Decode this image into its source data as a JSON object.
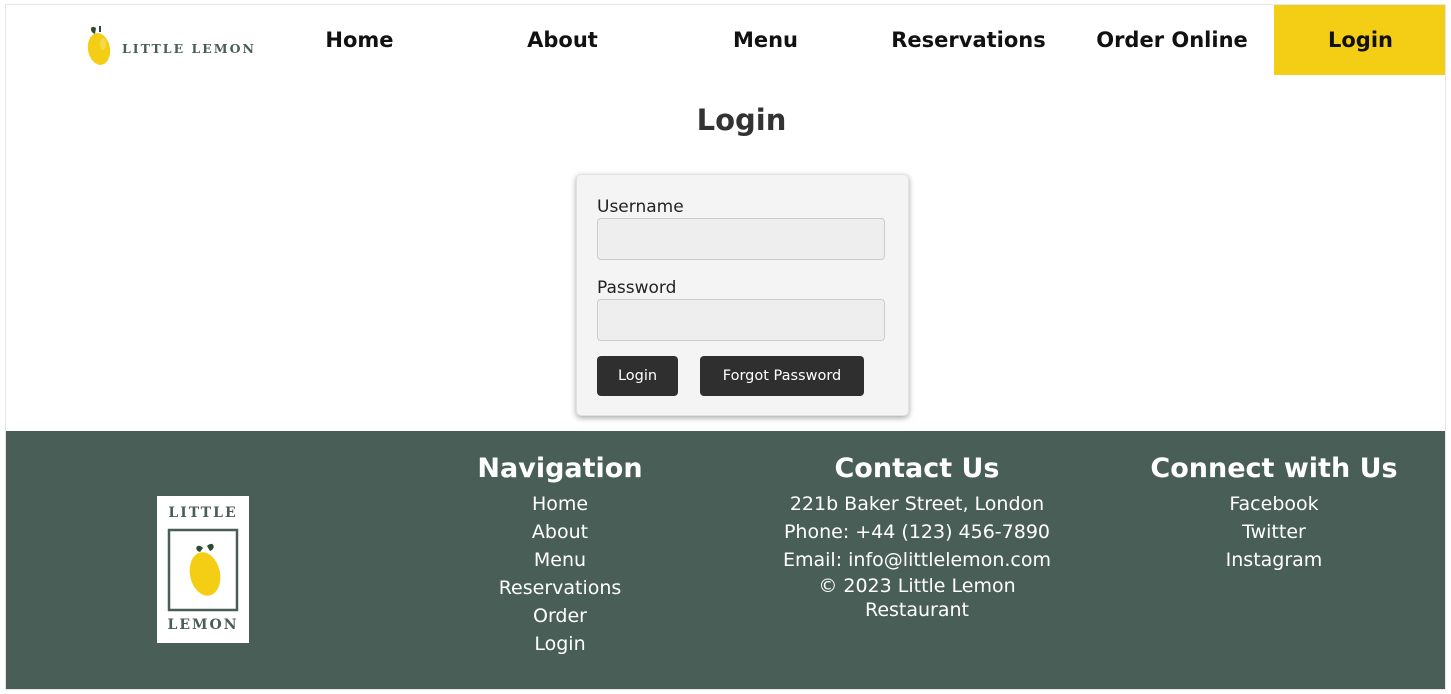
{
  "header": {
    "logo_text": "LITTLE LEMON",
    "nav": [
      {
        "label": "Home",
        "active": false
      },
      {
        "label": "About",
        "active": false
      },
      {
        "label": "Menu",
        "active": false
      },
      {
        "label": "Reservations",
        "active": false
      },
      {
        "label": "Order Online",
        "active": false
      },
      {
        "label": "Login",
        "active": true
      }
    ]
  },
  "main": {
    "title": "Login",
    "form": {
      "username_label": "Username",
      "username_value": "",
      "password_label": "Password",
      "password_value": "",
      "login_button": "Login",
      "forgot_button": "Forgot Password"
    }
  },
  "footer": {
    "logo_top": "LITTLE",
    "logo_bottom": "LEMON",
    "navigation": {
      "title": "Navigation",
      "links": [
        "Home",
        "About",
        "Menu",
        "Reservations",
        "Order",
        "Login"
      ]
    },
    "contact": {
      "title": "Contact Us",
      "address": "221b Baker Street, London",
      "phone": "Phone: +44 (123) 456-7890",
      "email": "Email: info@littlelemon.com",
      "copyright": "© 2023 Little Lemon Restaurant"
    },
    "social": {
      "title": "Connect with Us",
      "links": [
        "Facebook",
        "Twitter",
        "Instagram"
      ]
    }
  },
  "colors": {
    "primary_yellow": "#f4ce14",
    "primary_green": "#495e57",
    "button_dark": "#2f2f2f",
    "card_bg": "#f4f4f4"
  },
  "icons": {
    "logo_mark": "lemon-icon"
  }
}
